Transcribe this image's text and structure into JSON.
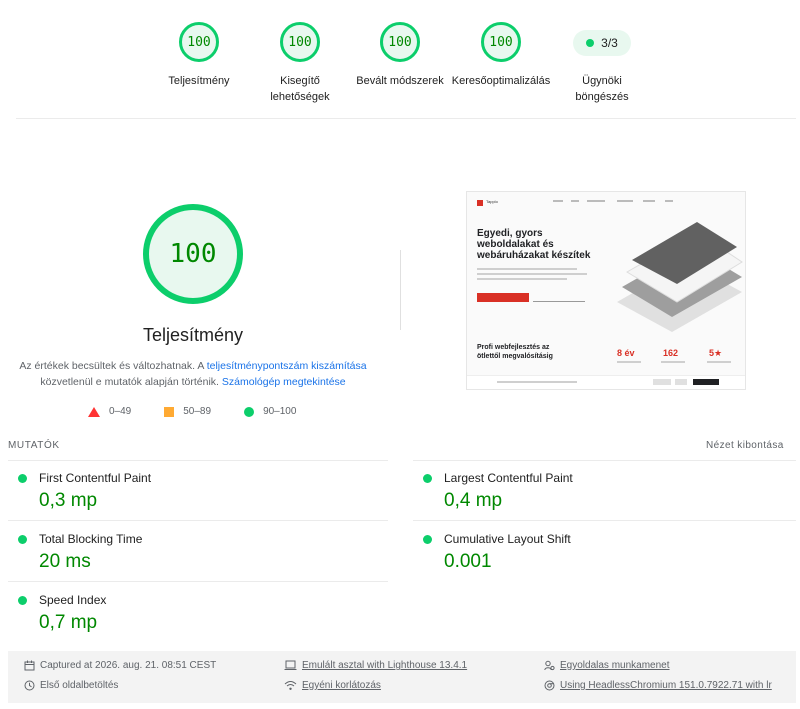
{
  "categories": [
    {
      "score": "100",
      "label_lines": [
        "Teljesítmény"
      ]
    },
    {
      "score": "100",
      "label_lines": [
        "Kisegítő",
        "lehetőségek"
      ]
    },
    {
      "score": "100",
      "label_lines": [
        "Bevált módszerek"
      ]
    },
    {
      "score": "100",
      "label_lines": [
        "Keresőoptimalizálás"
      ]
    }
  ],
  "agent": {
    "score": "3/3",
    "label_lines": [
      "Ügynöki",
      "böngészés"
    ]
  },
  "performance": {
    "score": "100",
    "title": "Teljesítmény",
    "desc_part1": "Az értékek becsültek és változhatnak. A ",
    "desc_link1": "teljesítménypontszám kiszámítása",
    "desc_part2": "közvetlenül e mutatók alapján történik. ",
    "desc_link2": "Számológép megtekintése"
  },
  "legend": {
    "fail": "0–49",
    "average": "50–89",
    "pass": "90–100"
  },
  "screenshot": {
    "logo_text": "Tapplo",
    "hero_line1": "Egyedi, gyors",
    "hero_line2": "weboldalakat és",
    "hero_line3": "webáruházakat készítek",
    "sub_line1": "Profi webfejlesztés az",
    "sub_line2": "ötlettől megvalósításig",
    "stats": [
      "8 év",
      "162",
      "5★"
    ]
  },
  "metrics_header": {
    "title": "MUTATÓK",
    "expand": "Nézet kibontása"
  },
  "metrics": [
    {
      "name": "First Contentful Paint",
      "value": "0,3 mp",
      "status_color": "#0cce6b"
    },
    {
      "name": "Largest Contentful Paint",
      "value": "0,4 mp",
      "status_color": "#0cce6b"
    },
    {
      "name": "Total Blocking Time",
      "value": "20 ms",
      "status_color": "#0cce6b"
    },
    {
      "name": "Cumulative Layout Shift",
      "value": "0.001",
      "status_color": "#0cce6b"
    },
    {
      "name": "Speed Index",
      "value": "0,7 mp",
      "status_color": "#0cce6b"
    }
  ],
  "footer": {
    "captured": "Captured at 2026. aug. 21. 08:51 CEST",
    "emulated": "Emulált asztal with Lighthouse 13.4.1",
    "session": "Egyoldalas munkamenet",
    "initial_load": "Első oldalbetöltés",
    "throttling": "Egyéni korlátozás",
    "browser": "Using HeadlessChromium 151.0.7922.71 with lr"
  },
  "colors": {
    "pass": "#0cce6b",
    "pass_text": "#008800",
    "average": "#ffaa33",
    "fail": "#ff3333",
    "link": "#1a73e8"
  },
  "icons": {
    "captured": "calendar-icon",
    "emulated": "laptop-icon",
    "session": "person-icon",
    "initial_load": "clock-icon",
    "throttling": "wifi-icon",
    "browser": "chrome-icon"
  }
}
